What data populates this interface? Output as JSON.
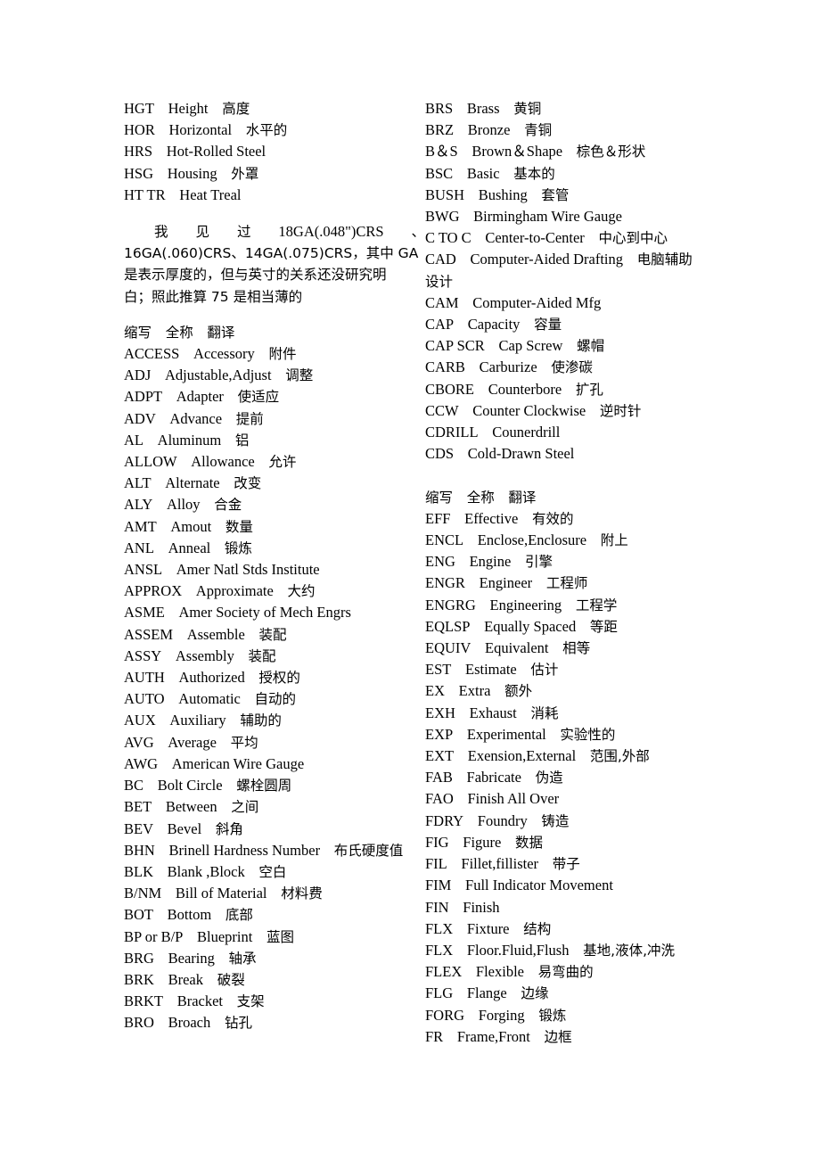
{
  "document": {
    "type": "engineering-abbreviation-glossary",
    "language": "zh-CN / en",
    "columns": 2
  },
  "left_column": {
    "top_entries": [
      {
        "abbr": "HGT",
        "full": "Height",
        "cn": "高度"
      },
      {
        "abbr": "HOR",
        "full": "Horizontal",
        "cn": "水平的"
      },
      {
        "abbr": "HRS",
        "full": "Hot-Rolled Steel",
        "cn": ""
      },
      {
        "abbr": "HSG",
        "full": "Housing",
        "cn": "外罩"
      },
      {
        "abbr": "HT TR",
        "full": "Heat Treal",
        "cn": ""
      }
    ],
    "paragraph": {
      "line1_segments": [
        "我",
        "见",
        "过",
        "18GA(.048\")CRS",
        "、"
      ],
      "line2": "16GA(.060)CRS、14GA(.075)CRS，其中 GA",
      "line3": "是表示厚度的，但与英寸的关系还没研究明",
      "line4": "白；照此推算 75 是相当薄的",
      "full_text": "我 见 过 18GA(.048\")CRS 、16GA(.060)CRS、14GA(.075)CRS，其中 GA 是表示厚度的，但与英寸的关系还没研究明白；照此推算 75 是相当薄的"
    },
    "table_header": {
      "abbr": "缩写",
      "full": "全称",
      "cn": "翻译"
    },
    "entries": [
      {
        "abbr": "ACCESS",
        "full": "Accessory",
        "cn": "附件"
      },
      {
        "abbr": "ADJ",
        "full": "Adjustable,Adjust",
        "cn": "调整"
      },
      {
        "abbr": "ADPT",
        "full": "Adapter",
        "cn": "使适应"
      },
      {
        "abbr": "ADV",
        "full": "Advance",
        "cn": "提前"
      },
      {
        "abbr": "AL",
        "full": "Aluminum",
        "cn": "铝"
      },
      {
        "abbr": "ALLOW",
        "full": "Allowance",
        "cn": "允许"
      },
      {
        "abbr": "ALT",
        "full": "Alternate",
        "cn": "改变"
      },
      {
        "abbr": "ALY",
        "full": "Alloy",
        "cn": "合金"
      },
      {
        "abbr": "AMT",
        "full": "Amout",
        "cn": "数量"
      },
      {
        "abbr": "ANL",
        "full": "Anneal",
        "cn": "锻炼"
      },
      {
        "abbr": "ANSL",
        "full": "Amer Natl Stds Institute",
        "cn": ""
      },
      {
        "abbr": "APPROX",
        "full": "Approximate",
        "cn": "大约"
      },
      {
        "abbr": "ASME",
        "full": "Amer Society of Mech Engrs",
        "cn": ""
      },
      {
        "abbr": "ASSEM",
        "full": "Assemble",
        "cn": "装配"
      },
      {
        "abbr": "ASSY",
        "full": "Assembly",
        "cn": "装配"
      },
      {
        "abbr": "AUTH",
        "full": "Authorized",
        "cn": "授权的"
      },
      {
        "abbr": "AUTO",
        "full": "Automatic",
        "cn": "自动的"
      },
      {
        "abbr": "AUX",
        "full": "Auxiliary",
        "cn": "辅助的"
      },
      {
        "abbr": "AVG",
        "full": "Average",
        "cn": "平均"
      },
      {
        "abbr": "AWG",
        "full": "American Wire Gauge",
        "cn": ""
      },
      {
        "abbr": "BC",
        "full": "Bolt Circle",
        "cn": "螺栓圆周"
      },
      {
        "abbr": "BET",
        "full": "Between",
        "cn": "之间"
      },
      {
        "abbr": "BEV",
        "full": "Bevel",
        "cn": "斜角"
      },
      {
        "abbr": "BHN",
        "full": "Brinell Hardness Number",
        "cn": "布氏硬度值"
      },
      {
        "abbr": "BLK",
        "full": "Blank ,Block",
        "cn": "空白"
      },
      {
        "abbr": "B/NM",
        "full": "Bill of Material",
        "cn": "材料费"
      },
      {
        "abbr": "BOT",
        "full": "Bottom",
        "cn": "底部"
      },
      {
        "abbr": "BP or B/P",
        "full": "Blueprint",
        "cn": "蓝图"
      },
      {
        "abbr": "BRG",
        "full": "Bearing",
        "cn": "轴承"
      },
      {
        "abbr": "BRK",
        "full": "Break",
        "cn": "破裂"
      },
      {
        "abbr": "BRKT",
        "full": "Bracket",
        "cn": "支架"
      },
      {
        "abbr": "BRO",
        "full": "Broach",
        "cn": "钻孔"
      }
    ]
  },
  "right_column": {
    "entries_top": [
      {
        "abbr": "BRS",
        "full": "Brass",
        "cn": "黄铜"
      },
      {
        "abbr": "BRZ",
        "full": "Bronze",
        "cn": "青铜"
      },
      {
        "abbr": "B＆S",
        "full": "Brown＆Shape",
        "cn": "棕色＆形状"
      },
      {
        "abbr": "BSC",
        "full": "Basic",
        "cn": "基本的"
      },
      {
        "abbr": "BUSH",
        "full": "Bushing",
        "cn": "套管"
      },
      {
        "abbr": "BWG",
        "full": "Birmingham Wire Gauge",
        "cn": ""
      },
      {
        "abbr": "C TO C",
        "full": "Center-to-Center",
        "cn": "中心到中心"
      },
      {
        "abbr": "CAD",
        "full": "Computer-Aided Drafting",
        "cn": "电脑辅助设计"
      },
      {
        "abbr": "CAM",
        "full": "Computer-Aided Mfg",
        "cn": ""
      },
      {
        "abbr": "CAP",
        "full": "Capacity",
        "cn": "容量"
      },
      {
        "abbr": "CAP SCR",
        "full": "Cap Screw",
        "cn": "螺帽"
      },
      {
        "abbr": "CARB",
        "full": "Carburize",
        "cn": "使渗碳"
      },
      {
        "abbr": "CBORE",
        "full": "Counterbore",
        "cn": "扩孔"
      },
      {
        "abbr": "CCW",
        "full": "Counter Clockwise",
        "cn": "逆时针"
      },
      {
        "abbr": "CDRILL",
        "full": "Counerdrill",
        "cn": ""
      },
      {
        "abbr": "CDS",
        "full": "Cold-Drawn Steel",
        "cn": ""
      }
    ],
    "table_header": {
      "abbr": "缩写",
      "full": "全称",
      "cn": "翻译"
    },
    "entries_bottom": [
      {
        "abbr": "EFF",
        "full": "Effective",
        "cn": "有效的"
      },
      {
        "abbr": "ENCL",
        "full": "Enclose,Enclosure",
        "cn": "附上"
      },
      {
        "abbr": "ENG",
        "full": "Engine",
        "cn": "引擎"
      },
      {
        "abbr": "ENGR",
        "full": "Engineer",
        "cn": "工程师"
      },
      {
        "abbr": "ENGRG",
        "full": "Engineering",
        "cn": "工程学"
      },
      {
        "abbr": "EQLSP",
        "full": "Equally Spaced",
        "cn": "等距"
      },
      {
        "abbr": "EQUIV",
        "full": "Equivalent",
        "cn": "相等"
      },
      {
        "abbr": "EST",
        "full": "Estimate",
        "cn": "估计"
      },
      {
        "abbr": "EX",
        "full": "Extra",
        "cn": "额外"
      },
      {
        "abbr": "EXH",
        "full": "Exhaust",
        "cn": "消耗"
      },
      {
        "abbr": "EXP",
        "full": "Experimental",
        "cn": "实验性的"
      },
      {
        "abbr": "EXT",
        "full": "Exension,External",
        "cn": "范围,外部"
      },
      {
        "abbr": "FAB",
        "full": "Fabricate",
        "cn": "伪造"
      },
      {
        "abbr": "FAO",
        "full": "Finish All Over",
        "cn": ""
      },
      {
        "abbr": "FDRY",
        "full": "Foundry",
        "cn": "铸造"
      },
      {
        "abbr": "FIG",
        "full": "Figure",
        "cn": "数据"
      },
      {
        "abbr": "FIL",
        "full": "Fillet,fillister",
        "cn": "带子"
      },
      {
        "abbr": "FIM",
        "full": "Full Indicator Movement",
        "cn": ""
      },
      {
        "abbr": "FIN",
        "full": "Finish",
        "cn": ""
      },
      {
        "abbr": "FLX",
        "full": "Fixture",
        "cn": "结构"
      },
      {
        "abbr": "FLX",
        "full": "Floor.Fluid,Flush",
        "cn": "基地,液体,冲洗"
      },
      {
        "abbr": "FLEX",
        "full": "Flexible",
        "cn": "易弯曲的"
      },
      {
        "abbr": "FLG",
        "full": "Flange",
        "cn": "边缘"
      },
      {
        "abbr": "FORG",
        "full": "Forging",
        "cn": "锻炼"
      },
      {
        "abbr": "FR",
        "full": "Frame,Front",
        "cn": "边框"
      }
    ]
  }
}
